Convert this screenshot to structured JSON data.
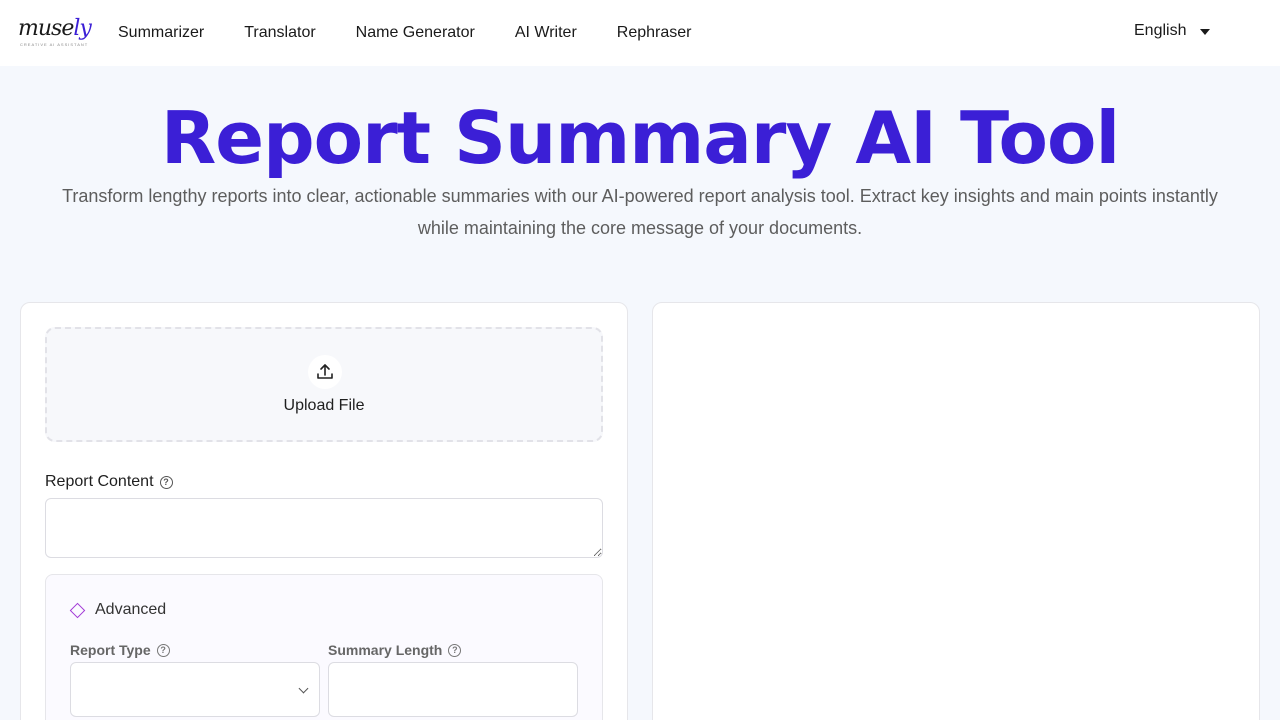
{
  "brand": {
    "logo_text": "muse",
    "logo_accent": "ly",
    "logo_tagline": "CREATIVE AI ASSISTANT"
  },
  "nav": {
    "items": [
      {
        "label": "Summarizer"
      },
      {
        "label": "Translator"
      },
      {
        "label": "Name Generator"
      },
      {
        "label": "AI Writer"
      },
      {
        "label": "Rephraser"
      }
    ],
    "language": "English"
  },
  "hero": {
    "title": "Report Summary AI Tool",
    "subtitle": "Transform lengthy reports into clear, actionable summaries with our AI-powered report analysis tool. Extract key insights and main points instantly while maintaining the core message of your documents."
  },
  "form": {
    "upload_label": "Upload File",
    "content_label": "Report Content",
    "content_value": "",
    "advanced_label": "Advanced",
    "report_type_label": "Report Type",
    "report_type_value": "",
    "summary_length_label": "Summary Length",
    "summary_length_value": ""
  },
  "icons": {
    "upload": "upload-icon",
    "help": "help-icon",
    "caret": "caret-down-icon",
    "advanced": "diamond-icon",
    "chevron": "chevron-down-icon"
  },
  "colors": {
    "accent": "#3b1fd6",
    "advanced_icon": "#a23ad6",
    "page_bg": "#f5f8fd"
  }
}
